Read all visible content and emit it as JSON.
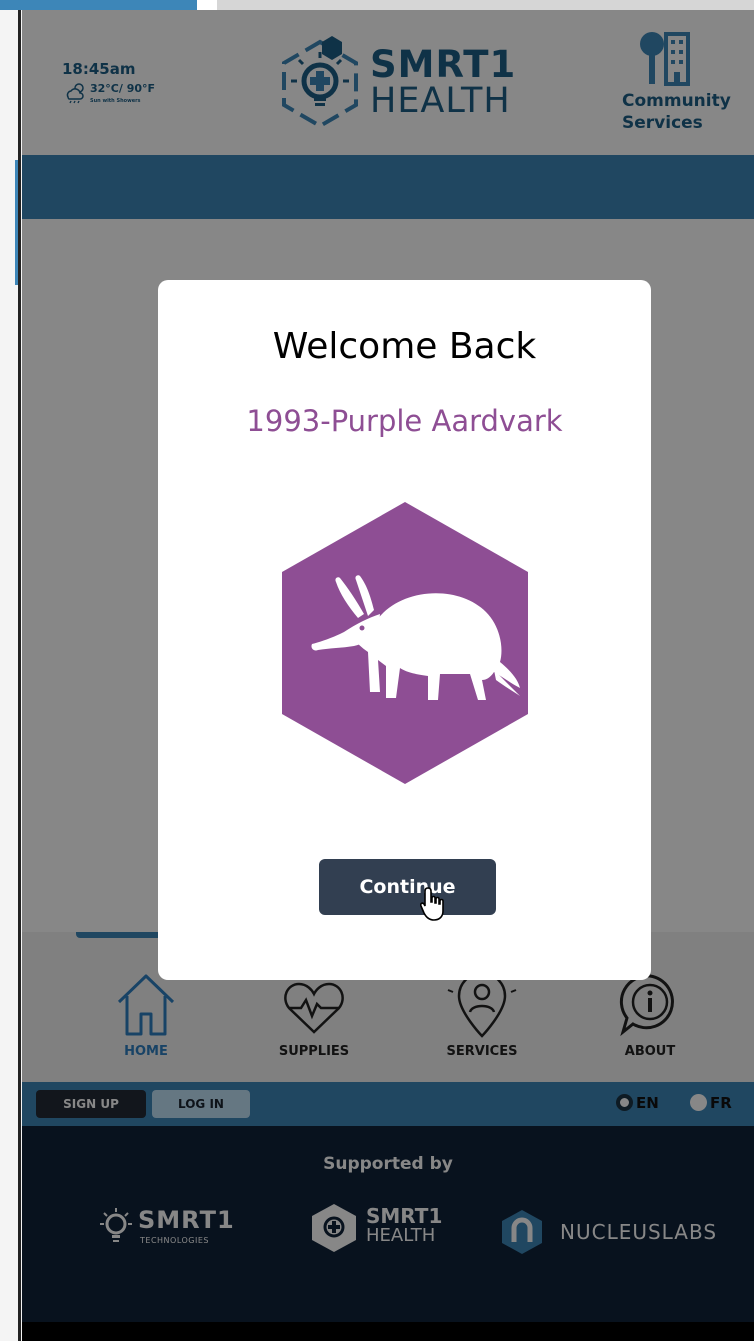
{
  "header": {
    "time": "18:45am",
    "temperature": "32°C/ 90°F",
    "weather_description": "Sun with Showers",
    "weather_icon": "cloud-sun-rain-icon",
    "logo_line1": "SMRT1",
    "logo_line2": "HEALTH",
    "community_icon": "tree-building-icon",
    "community_label_1": "Community",
    "community_label_2": "Services"
  },
  "nav": {
    "items": [
      {
        "label": "HOME",
        "icon": "home-icon",
        "active": true
      },
      {
        "label": "SUPPLIES",
        "icon": "heart-pulse-icon",
        "active": false
      },
      {
        "label": "SERVICES",
        "icon": "location-person-icon",
        "active": false
      },
      {
        "label": "ABOUT",
        "icon": "info-icon",
        "active": false
      }
    ]
  },
  "auth": {
    "signup_label": "SIGN UP",
    "login_label": "LOG IN",
    "lang_en": "EN",
    "lang_fr": "FR",
    "selected_language": "EN"
  },
  "footer": {
    "supported_by": "Supported by",
    "sponsor1_title": "SMRT1",
    "sponsor1_sub": "TECHNOLOGIES",
    "sponsor2_title": "SMRT1",
    "sponsor2_sub": "HEALTH",
    "sponsor3_title": "NUCLEUSLABS"
  },
  "modal": {
    "title": "Welcome Back",
    "user_name": "1993-Purple Aardvark",
    "avatar_icon": "aardvark-icon",
    "avatar_color": "#8e4e94",
    "continue_label": "Continue"
  },
  "colors": {
    "brand_blue": "#3d86b8",
    "navy": "#10233a",
    "button_dark": "#323f51",
    "purple": "#8e4e94"
  }
}
